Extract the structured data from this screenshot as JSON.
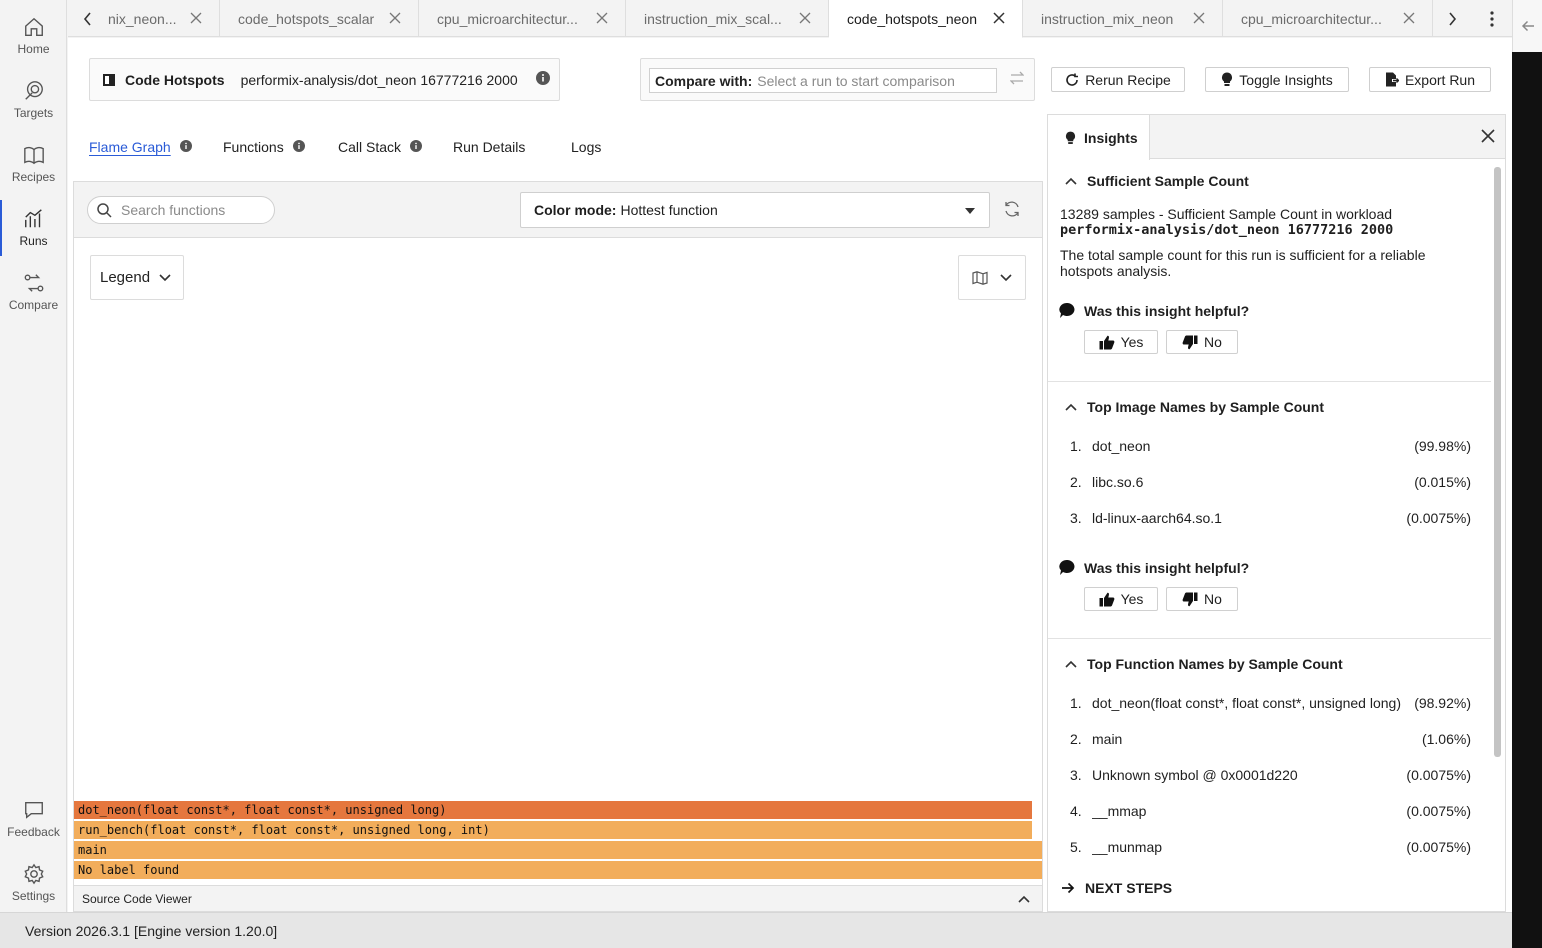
{
  "nav": {
    "items": [
      {
        "label": "Home",
        "icon": "home-icon"
      },
      {
        "label": "Targets",
        "icon": "target-icon"
      },
      {
        "label": "Recipes",
        "icon": "book-icon"
      },
      {
        "label": "Runs",
        "icon": "chart-icon"
      },
      {
        "label": "Compare",
        "icon": "compare-icon"
      }
    ],
    "bottom": [
      {
        "label": "Feedback",
        "icon": "feedback-icon"
      },
      {
        "label": "Settings",
        "icon": "gear-icon"
      }
    ]
  },
  "tabs": [
    {
      "label": "nix_neon...",
      "active": false
    },
    {
      "label": "code_hotspots_scalar",
      "active": false
    },
    {
      "label": "cpu_microarchitectur...",
      "active": false
    },
    {
      "label": "instruction_mix_scal...",
      "active": false
    },
    {
      "label": "code_hotspots_neon",
      "active": true
    },
    {
      "label": "instruction_mix_neon",
      "active": false
    },
    {
      "label": "cpu_microarchitectur...",
      "active": false
    }
  ],
  "header": {
    "title": "Code Hotspots",
    "run": "performix-analysis/dot_neon 16777216 2000"
  },
  "compare": {
    "label": "Compare with:",
    "placeholder": "Select a run to start comparison"
  },
  "actions": {
    "rerun": "Rerun Recipe",
    "toggle_insights": "Toggle Insights",
    "export": "Export Run"
  },
  "subtabs": [
    {
      "label": "Flame Graph",
      "active": true,
      "info": true
    },
    {
      "label": "Functions",
      "active": false,
      "info": true
    },
    {
      "label": "Call Stack",
      "active": false,
      "info": true
    },
    {
      "label": "Run Details",
      "active": false,
      "info": false
    },
    {
      "label": "Logs",
      "active": false,
      "info": false
    }
  ],
  "flame": {
    "search_placeholder": "Search functions",
    "color_mode_label": "Color mode:",
    "color_mode_value": "Hottest function",
    "legend_label": "Legend",
    "frames": [
      {
        "label": "dot_neon(float const*, float const*, unsigned long)",
        "color": "#e5773e",
        "width_fraction": 0.9892
      },
      {
        "label": "run_bench(float const*, float const*, unsigned long, int)",
        "color": "#f2ad5b",
        "width_fraction": 0.9892
      },
      {
        "label": "main",
        "color": "#f2ad5b",
        "width_fraction": 1.0
      },
      {
        "label": "No label found",
        "color": "#f2ad5b",
        "width_fraction": 1.0
      }
    ],
    "source_viewer_label": "Source Code Viewer"
  },
  "insights": {
    "tab_label": "Insights",
    "helpful_question": "Was this insight helpful?",
    "yes": "Yes",
    "no": "No",
    "sample_count": {
      "title": "Sufficient Sample Count",
      "line1": "13289 samples - Sufficient Sample Count in workload",
      "workload": "performix-analysis/dot_neon 16777216 2000",
      "description": "The total sample count for this run is sufficient for a reliable hotspots analysis."
    },
    "top_images": {
      "title": "Top Image Names by Sample Count",
      "items": [
        {
          "rank": "1.",
          "name": "dot_neon",
          "pct": "(99.98%)"
        },
        {
          "rank": "2.",
          "name": "libc.so.6",
          "pct": "(0.015%)"
        },
        {
          "rank": "3.",
          "name": "ld-linux-aarch64.so.1",
          "pct": "(0.0075%)"
        }
      ]
    },
    "top_functions": {
      "title": "Top Function Names by Sample Count",
      "items": [
        {
          "rank": "1.",
          "name": "dot_neon(float const*, float const*, unsigned long)",
          "pct": "(98.92%)"
        },
        {
          "rank": "2.",
          "name": "main",
          "pct": "(1.06%)"
        },
        {
          "rank": "3.",
          "name": "Unknown symbol @ 0x0001d220",
          "pct": "(0.0075%)"
        },
        {
          "rank": "4.",
          "name": "__mmap",
          "pct": "(0.0075%)"
        },
        {
          "rank": "5.",
          "name": "__munmap",
          "pct": "(0.0075%)"
        }
      ]
    },
    "next_steps": "NEXT STEPS"
  },
  "status": {
    "version": "Version 2026.3.1 [Engine version 1.20.0]"
  }
}
